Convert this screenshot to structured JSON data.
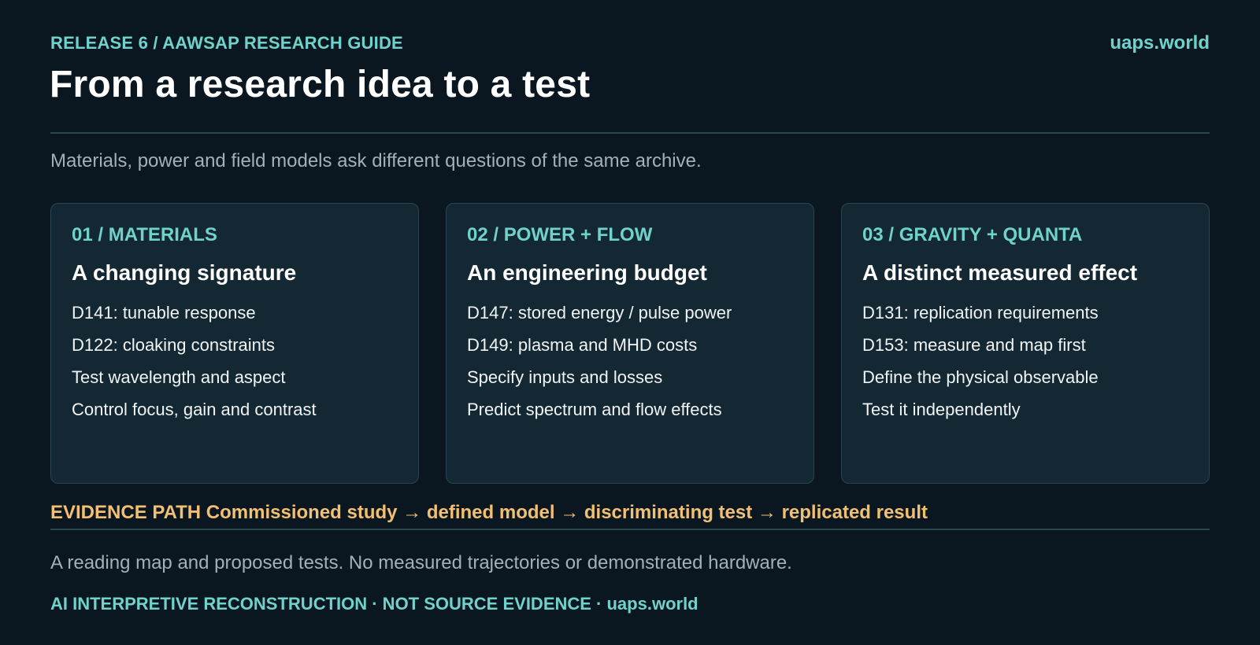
{
  "header": {
    "eyebrow": "RELEASE 6 / AAWSAP RESEARCH GUIDE",
    "site": "uaps.world",
    "title": "From a research idea to a test",
    "subtitle": "Materials, power and field models ask different questions of the same archive."
  },
  "cards": [
    {
      "tag": "01 / MATERIALS",
      "heading": "A changing signature",
      "items": [
        "D141: tunable response",
        "D122: cloaking constraints",
        "Test wavelength and aspect",
        "Control focus, gain and contrast"
      ]
    },
    {
      "tag": "02 / POWER + FLOW",
      "heading": "An engineering budget",
      "items": [
        "D147: stored energy / pulse power",
        "D149: plasma and MHD costs",
        "Specify inputs and losses",
        "Predict spectrum and flow effects"
      ]
    },
    {
      "tag": "03 / GRAVITY + QUANTA",
      "heading": "A distinct measured effect",
      "items": [
        "D131: replication requirements",
        "D153: measure and map first",
        "Define the physical observable",
        "Test it independently"
      ]
    }
  ],
  "evidence_path": "EVIDENCE PATH Commissioned study → defined model → discriminating test → replicated result",
  "note": "A reading map and proposed tests. No measured trajectories or demonstrated hardware.",
  "footer": "AI INTERPRETIVE RECONSTRUCTION · NOT SOURCE EVIDENCE · uaps.world",
  "colors": {
    "background": "#0b1720",
    "accent": "#6fd3cc",
    "highlight": "#f2c072",
    "card": "#132833"
  }
}
